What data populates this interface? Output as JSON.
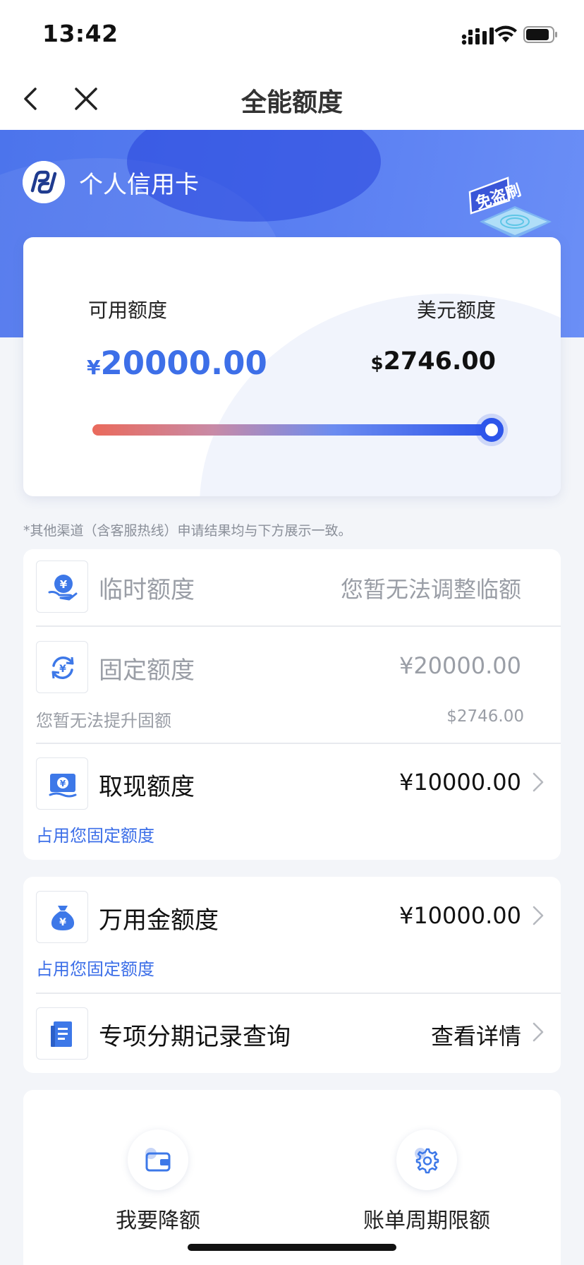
{
  "status_bar": {
    "time": "13:42"
  },
  "nav": {
    "title": "全能额度"
  },
  "hero": {
    "bank_name": "个人信用卡",
    "badge": "免盗刷"
  },
  "limit": {
    "available_label": "可用额度",
    "available_currency": "¥",
    "available_amount": "20000.00",
    "usd_label": "美元额度",
    "usd_currency": "$",
    "usd_amount": "2746.00",
    "slider_level": 1.0
  },
  "note": "*其他渠道（含客服热线）申请结果均与下方展示一致。",
  "rows": {
    "temp": {
      "label": "临时额度",
      "value": "您暂无法调整临额"
    },
    "fixed": {
      "label": "固定额度",
      "value": "¥20000.00",
      "sub": "您暂无法提升固额",
      "sub_value": "$2746.00"
    },
    "cash": {
      "label": "取现额度",
      "value": "¥10000.00",
      "sub": "占用您固定额度"
    },
    "wanyong": {
      "label": "万用金额度",
      "value": "¥10000.00",
      "sub": "占用您固定额度"
    },
    "installment": {
      "label": "专项分期记录查询",
      "value": "查看详情"
    }
  },
  "bottom": {
    "left_label": "我要降额",
    "right_label": "账单周期限额"
  },
  "colors": {
    "accent": "#3d6fe8",
    "hero": "#5b80f2",
    "grey_text": "#9a9ea6"
  }
}
